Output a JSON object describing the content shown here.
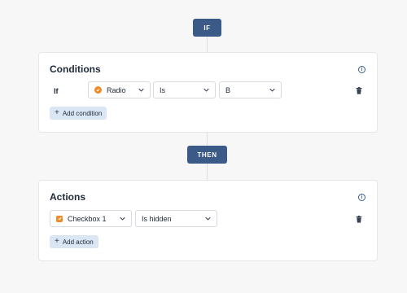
{
  "flow": {
    "if_label": "IF",
    "then_label": "THEN"
  },
  "conditions": {
    "title": "Conditions",
    "row_label": "If",
    "field": {
      "value": "Radio",
      "icon": "radio-icon"
    },
    "operator": {
      "value": "Is"
    },
    "compare_value": {
      "value": "B"
    },
    "add_label": "Add condition"
  },
  "actions": {
    "title": "Actions",
    "field": {
      "value": "Checkbox 1",
      "icon": "checkbox-icon"
    },
    "action": {
      "value": "Is hidden"
    },
    "add_label": "Add action"
  },
  "colors": {
    "accent": "#3b5a87",
    "field_icon": "#f08a24",
    "add_button_bg": "#dbe6f5"
  }
}
